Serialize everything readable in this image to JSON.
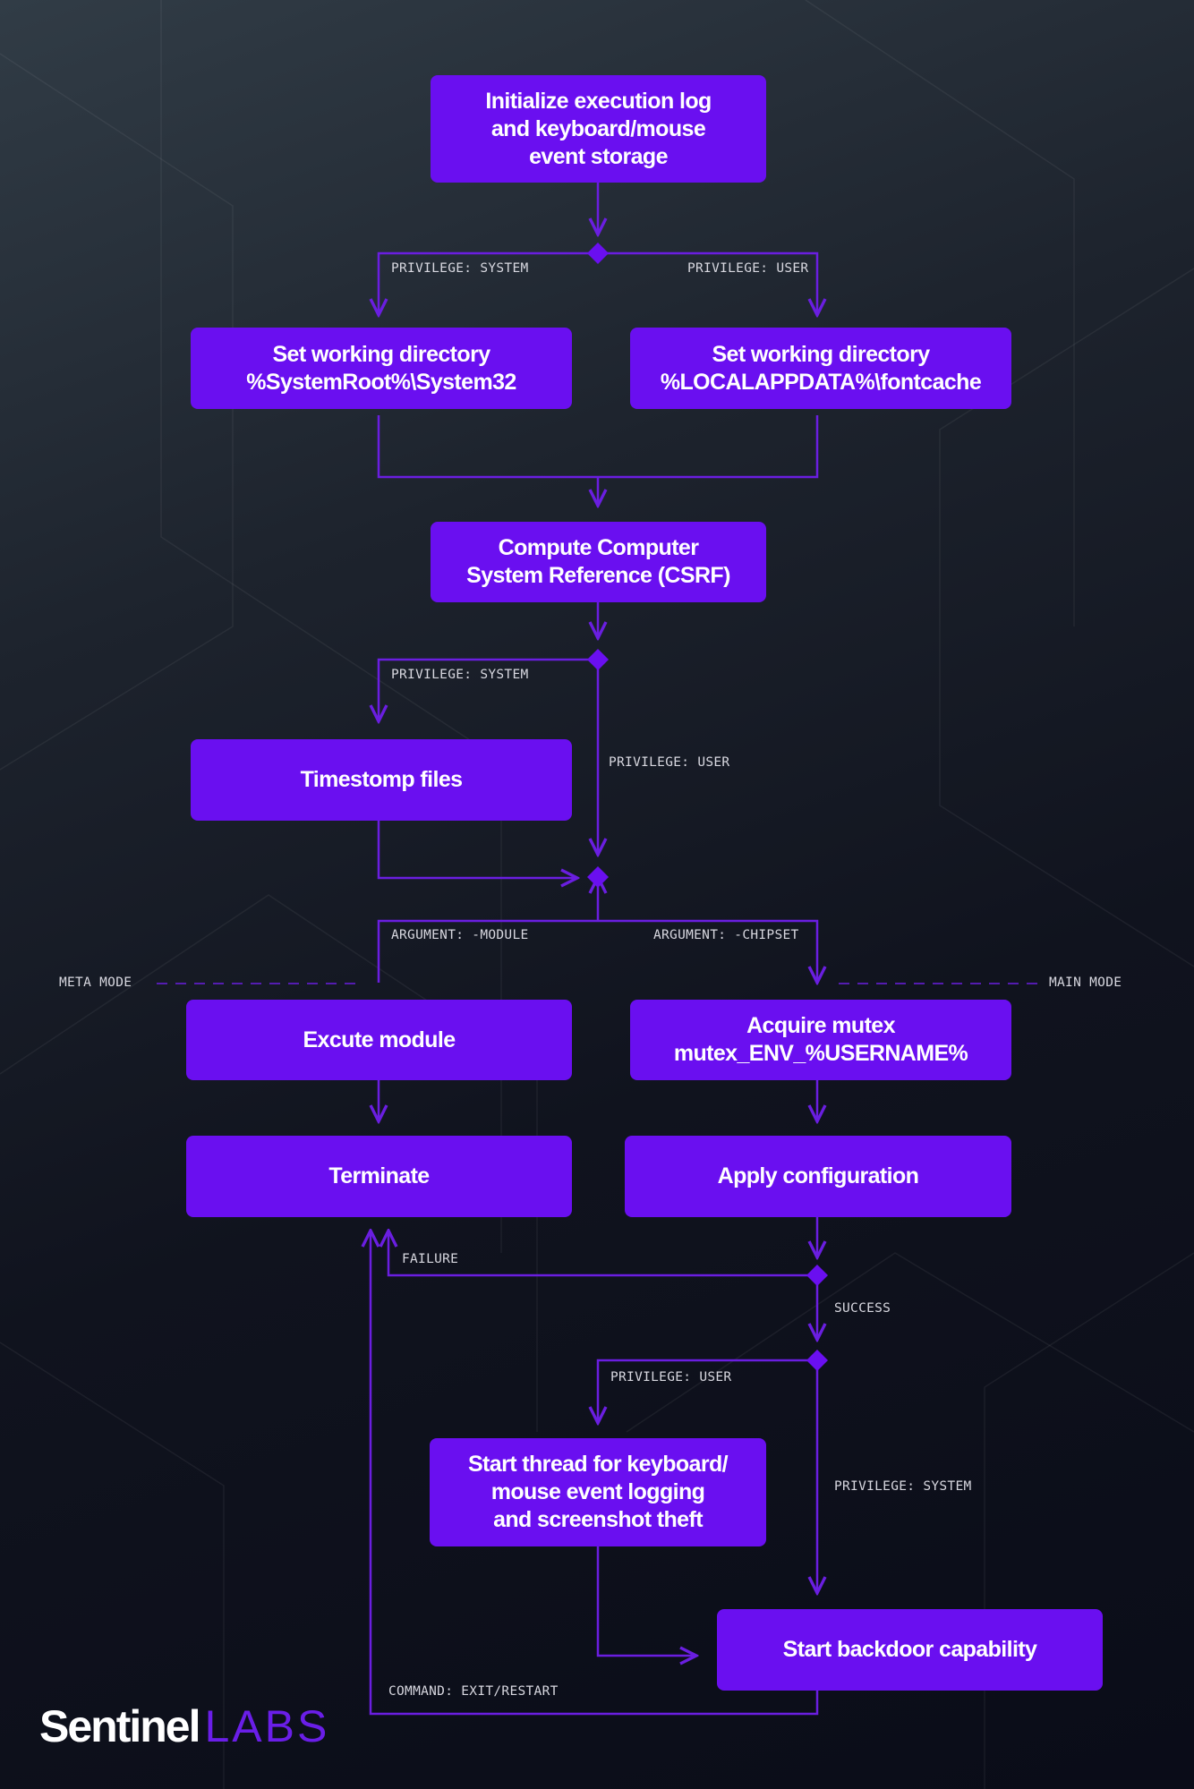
{
  "colors": {
    "box": "#6a0ff0",
    "connector": "#6a1ee0",
    "label": "#d8d8e0"
  },
  "boxes": {
    "init": "Initialize execution log\nand keyboard/mouse\nevent storage",
    "sysroot": "Set working directory\n%SystemRoot%\\System32",
    "localappdata": "Set working directory\n%LOCALAPPDATA%\\fontcache",
    "csrf": "Compute Computer\nSystem Reference (CSRF)",
    "timestomp": "Timestomp files",
    "execute": "Excute module",
    "mutex": "Acquire mutex\nmutex_ENV_%USERNAME%",
    "terminate": "Terminate",
    "apply": "Apply configuration",
    "thread": "Start thread for keyboard/\nmouse event logging\nand screenshot theft",
    "backdoor": "Start backdoor capability"
  },
  "labels": {
    "priv_system_1": "PRIVILEGE: SYSTEM",
    "priv_user_1": "PRIVILEGE: USER",
    "priv_system_2": "PRIVILEGE: SYSTEM",
    "priv_user_2": "PRIVILEGE: USER",
    "arg_module": "ARGUMENT: -MODULE",
    "arg_chipset": "ARGUMENT: -CHIPSET",
    "meta_mode": "META MODE",
    "main_mode": "MAIN MODE",
    "failure": "FAILURE",
    "success": "SUCCESS",
    "priv_user_3": "PRIVILEGE: USER",
    "priv_system_3": "PRIVILEGE: SYSTEM",
    "command": "COMMAND: EXIT/RESTART"
  },
  "logo": {
    "part1": "Sentinel",
    "part2": "LABS"
  }
}
